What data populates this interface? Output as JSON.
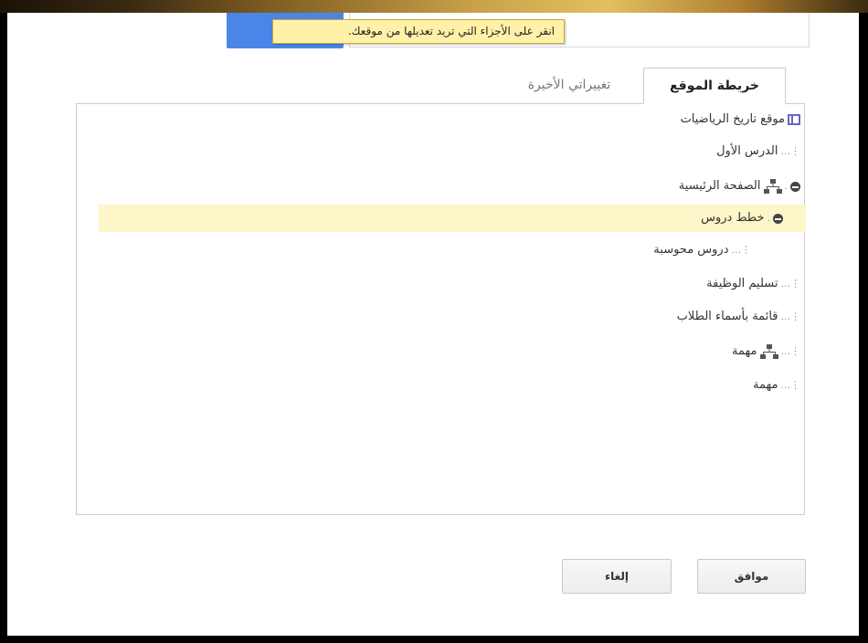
{
  "tooltip": {
    "text": "انقر على الأجزاء التي تريد تعديلها من موقعك."
  },
  "tabs": {
    "site_map": "خريطة الموقع",
    "recent_changes": "تغييراتي الأخيرة"
  },
  "tree": {
    "items": [
      {
        "label": "موقع تاريخ الرياضيات"
      },
      {
        "label": "الدرس الأول"
      },
      {
        "label": "الصفحة الرئيسية"
      },
      {
        "label": "خطط دروس"
      },
      {
        "label": "دروس محوسبة"
      },
      {
        "label": "تسليم الوظيفة"
      },
      {
        "label": "قائمة بأسماء الطلاب"
      },
      {
        "label": "مهمة"
      },
      {
        "label": "مهمة"
      }
    ],
    "dots": "⋮..."
  },
  "buttons": {
    "ok": "موافق",
    "cancel": "إلغاء"
  },
  "colors": {
    "selected_row": "#fcf6c8",
    "tooltip_bg": "#fff1a8",
    "site_icon": "#6466c8",
    "blue_button": "#4a86e8"
  }
}
